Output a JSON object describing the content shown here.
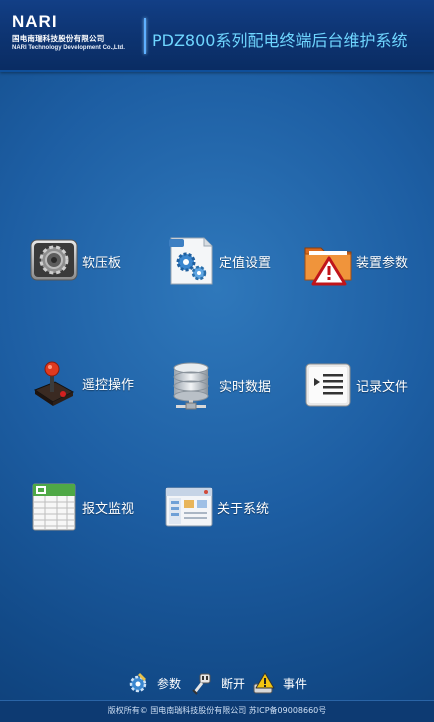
{
  "header": {
    "logo_text": "NARI",
    "logo_cn": "国电南瑞科技股份有限公司",
    "logo_en": "NARI Technology Development Co.,Ltd.",
    "title": "PDZ800系列配电终端后台维护系统"
  },
  "menu": {
    "soft_plate": {
      "label": "软压板",
      "icon": "gear-icon"
    },
    "setting_values": {
      "label": "定值设置",
      "icon": "settings-document-icon"
    },
    "device_params": {
      "label": "装置参数",
      "icon": "warning-folder-icon"
    },
    "remote_control": {
      "label": "遥控操作",
      "icon": "joystick-icon"
    },
    "realtime_data": {
      "label": "实时数据",
      "icon": "database-icon"
    },
    "record_files": {
      "label": "记录文件",
      "icon": "list-file-icon"
    },
    "message_monitor": {
      "label": "报文监视",
      "icon": "spreadsheet-icon"
    },
    "about_system": {
      "label": "关于系统",
      "icon": "window-icon"
    }
  },
  "toolbar": {
    "params_label": "参数",
    "disconnect_label": "断开",
    "events_label": "事件"
  },
  "footer": {
    "copyright": "版权所有© 国电南瑞科技股份有限公司    苏ICP备09008660号"
  }
}
